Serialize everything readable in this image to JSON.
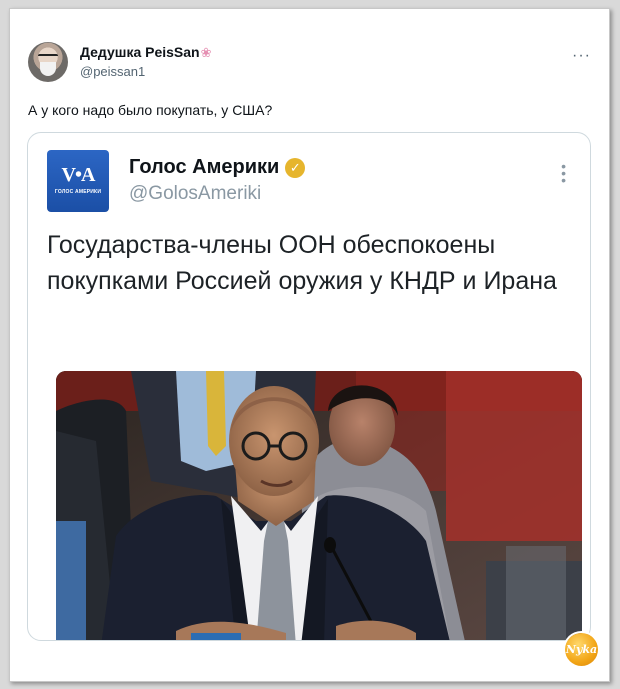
{
  "post": {
    "author_name": "Дедушка PeisSan",
    "author_handle": "@peissan1",
    "text": "А у кого надо было покупать, у США?",
    "more_icon": "more-horizontal-icon"
  },
  "quoted": {
    "logo_mark": "V•A",
    "logo_sub": "ГОЛОС АМЕРИКИ",
    "author_name": "Голос Америки",
    "author_handle": "@GolosAmeriki",
    "verified_icon": "verified-badge-icon",
    "text": "Государства-члены ООН обеспокоены покупками Россией оружия у КНДР и Ирана",
    "more_icon": "more-vertical-icon"
  },
  "watermark": {
    "text": "Nyka"
  }
}
